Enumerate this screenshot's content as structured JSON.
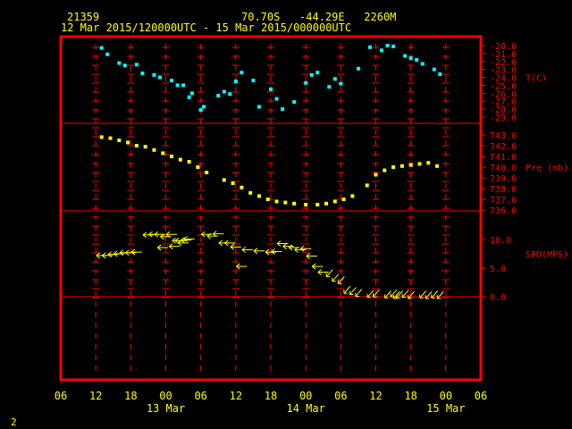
{
  "header": {
    "station_id": "21359",
    "location": "70.70S   -44.29E   2260M",
    "time_range": "12 Mar 2015/120000UTC - 15 Mar 2015/000000UTC"
  },
  "footer": {
    "page_number": "2"
  },
  "colors": {
    "frame": "#ff0000",
    "ticks": "#ff0000",
    "temperature": "#00ffff",
    "pressure": "#ffff00",
    "wind": "#ffff00",
    "label_text": "#ffff00",
    "axis_labels": "#ff0000"
  },
  "chart_data": [
    {
      "type": "scatter",
      "panel": "temperature",
      "label": "T(C)",
      "ylim": [
        -29.0,
        -20.0
      ],
      "y_ticks": [
        "-20.0",
        "-21.0",
        "-22.0",
        "-23.0",
        "-24.0",
        "-25.0",
        "-26.0",
        "-27.0",
        "-28.0",
        "-29.0"
      ],
      "x_hours": [
        13,
        14,
        16,
        17,
        19,
        20,
        22,
        23,
        25,
        26,
        27,
        28,
        28.5,
        30,
        30.5,
        33,
        34,
        35,
        36,
        37,
        39,
        40,
        42,
        43,
        44,
        46,
        48,
        49,
        50,
        52,
        53,
        54,
        57,
        59,
        61,
        62,
        63,
        65,
        66,
        67,
        68,
        70,
        71
      ],
      "values": [
        -20.3,
        -21.1,
        -22.2,
        -22.5,
        -22.4,
        -23.5,
        -23.7,
        -24.0,
        -24.4,
        -25.0,
        -25.0,
        -26.5,
        -26.0,
        -28.1,
        -27.7,
        -26.3,
        -25.8,
        -26.1,
        -24.5,
        -23.4,
        -24.4,
        -27.7,
        -25.5,
        -26.7,
        -28.0,
        -27.1,
        -24.7,
        -23.7,
        -23.4,
        -25.2,
        -24.2,
        -24.8,
        -22.9,
        -20.2,
        -20.6,
        -20.0,
        -20.1,
        -21.3,
        -21.6,
        -21.8,
        -22.3,
        -23.0,
        -23.6
      ],
      "x_range_hours": [
        6,
        78
      ]
    },
    {
      "type": "scatter",
      "panel": "pressure",
      "label": "Pre (mb)",
      "ylim": [
        736.0,
        743.0
      ],
      "y_ticks": [
        "743.0",
        "742.0",
        "741.0",
        "740.0",
        "739.0",
        "738.0",
        "737.0",
        "736.0"
      ],
      "x_hours": [
        13,
        14.5,
        16,
        17.5,
        19,
        20.5,
        22,
        23.5,
        25,
        26.5,
        28,
        29.5,
        31,
        34,
        35.5,
        37,
        38.5,
        40,
        41.5,
        43,
        44.5,
        46,
        48,
        50,
        51.5,
        53,
        54.5,
        56,
        58.5,
        60,
        61.5,
        63,
        64.5,
        66,
        67.5,
        69,
        70.5
      ],
      "values": [
        742.8,
        742.7,
        742.5,
        742.3,
        742.0,
        741.9,
        741.6,
        741.3,
        741.0,
        740.7,
        740.5,
        740.0,
        739.5,
        738.8,
        738.5,
        738.1,
        737.6,
        737.3,
        737.0,
        736.8,
        736.7,
        736.6,
        736.5,
        736.5,
        736.6,
        736.8,
        737.0,
        737.3,
        738.3,
        739.3,
        739.7,
        740.0,
        740.1,
        740.2,
        740.3,
        740.4,
        740.1
      ],
      "x_range_hours": [
        6,
        78
      ]
    },
    {
      "type": "scatter",
      "panel": "wind",
      "label": "SPD(MPS)",
      "ylim": [
        0.0,
        10.0
      ],
      "y_ticks": [
        "10.0",
        "5.0",
        "0.0"
      ],
      "x_hours": [
        13,
        14,
        15,
        16,
        17,
        18,
        19,
        21,
        22,
        23,
        23.5,
        24,
        25,
        25.5,
        26,
        26.5,
        27,
        27.5,
        28,
        31,
        32,
        33,
        34,
        35,
        36,
        37,
        38,
        40,
        42,
        43,
        44,
        45,
        46,
        47,
        48,
        49,
        50,
        51,
        52,
        53,
        54,
        55,
        56,
        57,
        59,
        60,
        62,
        63,
        63.5,
        64,
        65,
        66,
        68,
        69,
        70,
        71
      ],
      "values": [
        7.2,
        7.2,
        7.4,
        7.5,
        7.7,
        7.7,
        7.8,
        10.8,
        10.9,
        10.9,
        8.6,
        10.5,
        10.9,
        8.8,
        9.8,
        9.8,
        9.4,
        9.9,
        10.1,
        10.9,
        10.6,
        11.0,
        9.4,
        9.4,
        8.7,
        5.3,
        8.2,
        8.0,
        7.8,
        7.9,
        9.3,
        8.8,
        8.6,
        8.2,
        8.4,
        7.1,
        5.3,
        4.3,
        3.8,
        3.0,
        2.6,
        0.9,
        0.7,
        0.4,
        0.2,
        0.3,
        0.1,
        0.3,
        0.0,
        0.1,
        0.2,
        0.0,
        0.1,
        0.0,
        0.1,
        0.0
      ],
      "x_range_hours": [
        6,
        78
      ]
    }
  ],
  "x_axis": {
    "tick_labels": [
      "06",
      "12",
      "18",
      "00",
      "06",
      "12",
      "18",
      "00",
      "06",
      "12",
      "18",
      "00",
      "06"
    ],
    "tick_hours": [
      6,
      12,
      18,
      24,
      30,
      36,
      42,
      48,
      54,
      60,
      66,
      72,
      78
    ],
    "date_labels": [
      {
        "text": "13 Mar",
        "hour": 24
      },
      {
        "text": "14 Mar",
        "hour": 48
      },
      {
        "text": "15 Mar",
        "hour": 72
      }
    ]
  }
}
